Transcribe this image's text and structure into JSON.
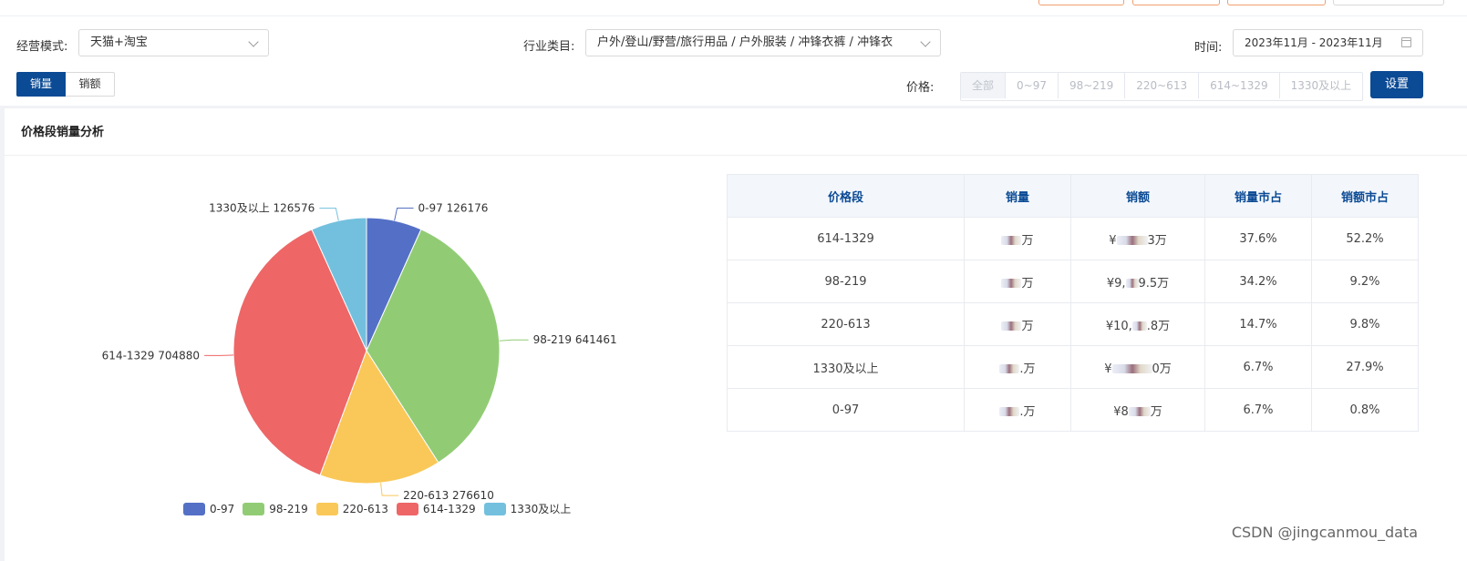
{
  "filters": {
    "mode_label": "经营模式:",
    "mode_value": "天猫+淘宝",
    "industry_label": "行业类目:",
    "industry_value": "户外/登山/野营/旅行用品 / 户外服装 / 冲锋衣裤 / 冲锋衣",
    "time_label": "时间:",
    "time_value": "2023年11月 - 2023年11月",
    "metric_tabs": [
      "销量",
      "销额"
    ],
    "price_label": "价格:",
    "price_options": [
      "全部",
      "0~97",
      "98~219",
      "220~613",
      "614~1329",
      "1330及以上"
    ],
    "set_button": "设置"
  },
  "panel": {
    "title": "价格段销量分析"
  },
  "chart_data": {
    "type": "pie",
    "title": "价格段销量分析",
    "categories": [
      "0-97",
      "98-219",
      "220-613",
      "614-1329",
      "1330及以上"
    ],
    "values": [
      126176,
      641461,
      276610,
      704880,
      126576
    ],
    "colors": [
      "#5470c6",
      "#91cc75",
      "#fac858",
      "#ee6666",
      "#73c0de"
    ],
    "legend_position": "bottom"
  },
  "table": {
    "headers": [
      "价格段",
      "销量",
      "销额",
      "销量市占",
      "销额市占"
    ],
    "rows": [
      {
        "segment": "614-1329",
        "sales_suffix": "万",
        "revenue_prefix": "¥",
        "revenue_suffix": "3万",
        "volume_share": "37.6%",
        "revenue_share": "52.2%"
      },
      {
        "segment": "98-219",
        "sales_suffix": "万",
        "revenue_prefix": "¥9,",
        "revenue_suffix": "9.5万",
        "volume_share": "34.2%",
        "revenue_share": "9.2%"
      },
      {
        "segment": "220-613",
        "sales_suffix": "万",
        "revenue_prefix": "¥10,",
        "revenue_suffix": ".8万",
        "volume_share": "14.7%",
        "revenue_share": "9.8%"
      },
      {
        "segment": "1330及以上",
        "sales_suffix": ".万",
        "revenue_prefix": "¥",
        "revenue_suffix": "0万",
        "volume_share": "6.7%",
        "revenue_share": "27.9%"
      },
      {
        "segment": "0-97",
        "sales_suffix": ".万",
        "revenue_prefix": "¥8",
        "revenue_suffix": "万",
        "volume_share": "6.7%",
        "revenue_share": "0.8%"
      }
    ]
  },
  "watermark": "CSDN @jingcanmou_data"
}
